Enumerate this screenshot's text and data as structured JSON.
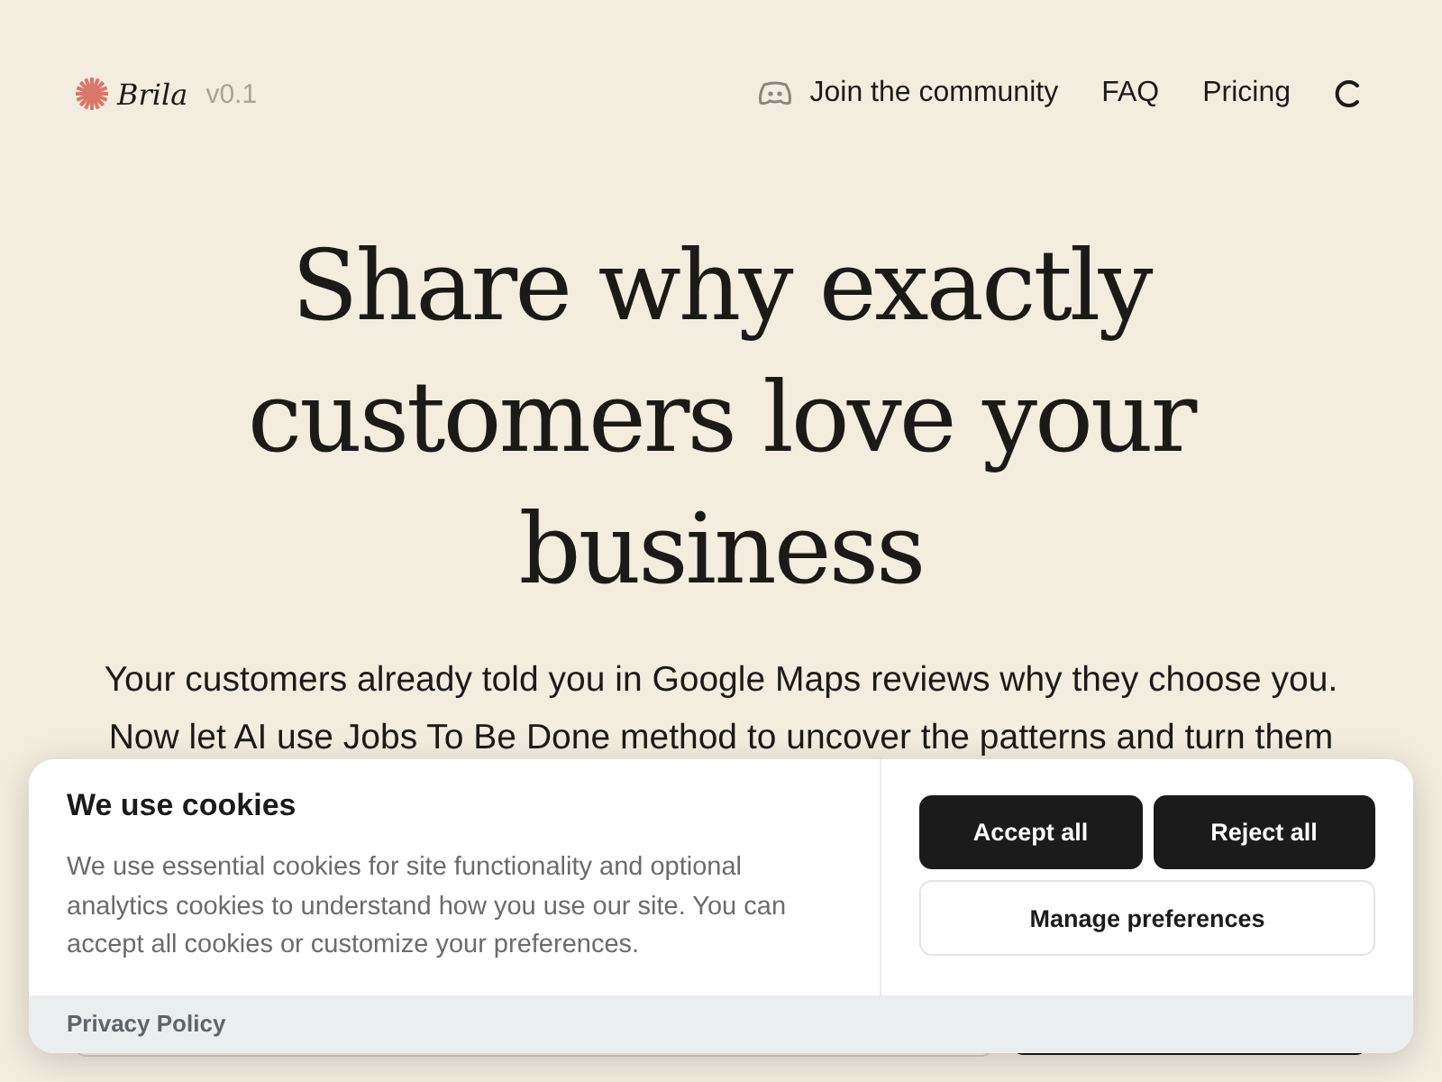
{
  "header": {
    "logo": "Brila",
    "version": "v0.1",
    "nav": [
      {
        "kind": "discord",
        "label": "Join the community"
      },
      {
        "kind": "link",
        "label": "FAQ"
      },
      {
        "kind": "link",
        "label": "Pricing"
      }
    ]
  },
  "hero": {
    "title": "Share why exactly customers love your business",
    "lines": [
      "Your customers already told you in Google Maps reviews why they choose you.",
      "Now let AI use Jobs To Be Done method to uncover the patterns and turn them"
    ]
  },
  "cookie_banner": {
    "title": "We use cookies",
    "text": "We use essential cookies for site functionality and optional analytics cookies to understand how you use our site. You can accept all cookies or customize your preferences.",
    "buttons": [
      {
        "kind": "primary",
        "label": "Accept all"
      },
      {
        "kind": "primary",
        "label": "Reject all"
      },
      {
        "kind": "secondary",
        "label": "Manage preferences"
      }
    ],
    "footer_link": "Privacy Policy"
  }
}
